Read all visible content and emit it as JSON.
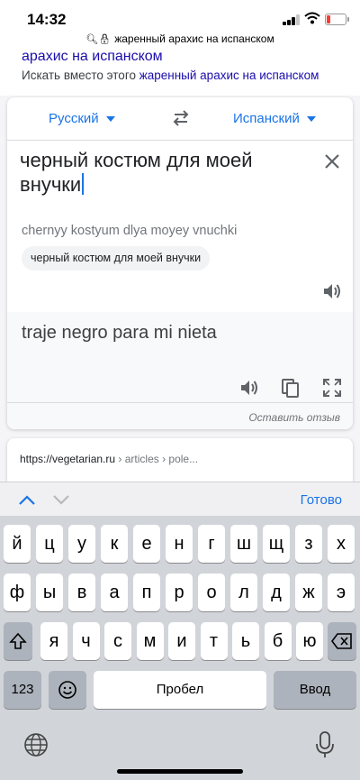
{
  "status": {
    "time": "14:32"
  },
  "urlbar": {
    "text": "жаренный арахис на испанском"
  },
  "page": {
    "cut_link": "арахис на испанском",
    "instead_prefix": "Искать вместо этого",
    "instead_link": "жаренный арахис на испанском"
  },
  "translator": {
    "source_lang": "Русский",
    "target_lang": "Испанский",
    "source_line1": "черный костюм для моей",
    "source_line2": "внучки",
    "transliteration": "chernyy kostyum dlya moyey vnuchki",
    "suggestion_chip": "черный костюм для моей внучки",
    "translation": "traje negro para mi nieta",
    "feedback": "Оставить отзыв"
  },
  "result": {
    "site": "https://vegetarian.ru",
    "path": " › articles › pole..."
  },
  "accessory": {
    "done": "Готово"
  },
  "keyboard": {
    "row1": [
      "й",
      "ц",
      "у",
      "к",
      "е",
      "н",
      "г",
      "ш",
      "щ",
      "з",
      "х"
    ],
    "row2": [
      "ф",
      "ы",
      "в",
      "а",
      "п",
      "р",
      "о",
      "л",
      "д",
      "ж",
      "э"
    ],
    "row3": [
      "я",
      "ч",
      "с",
      "м",
      "и",
      "т",
      "ь",
      "б",
      "ю"
    ],
    "numbers": "123",
    "space": "Пробел",
    "enter": "Ввод"
  },
  "colors": {
    "accent": "#1a73e8",
    "link": "#1a0dab",
    "keyboard_bg": "#d1d4d9"
  }
}
